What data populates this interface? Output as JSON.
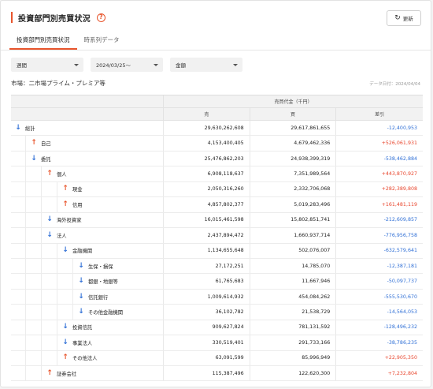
{
  "header": {
    "title": "投資部門別売買状況",
    "help_icon": "?",
    "update_label": "更新",
    "update_icon": "↻"
  },
  "tabs": [
    {
      "label": "投資部門別売買状況",
      "active": true
    },
    {
      "label": "時系列データ",
      "active": false
    }
  ],
  "filters": [
    {
      "value": "週間"
    },
    {
      "value": "2024/03/25〜"
    },
    {
      "value": "金額"
    }
  ],
  "market_label": "市場：二市場プライム・プレミア等",
  "data_date": "データ日付：2024/04/04",
  "table": {
    "group_header": "売買代金（千円）",
    "columns": [
      "売",
      "買",
      "差引"
    ],
    "rows": [
      {
        "label": "総計",
        "level": 0,
        "dir": "down",
        "sell": "29,630,262,608",
        "buy": "29,617,861,655",
        "diff": "-12,400,953"
      },
      {
        "label": "自己",
        "level": 1,
        "dir": "up",
        "sell": "4,153,400,405",
        "buy": "4,679,462,336",
        "diff": "+526,061,931"
      },
      {
        "label": "委託",
        "level": 1,
        "dir": "down",
        "sell": "25,476,862,203",
        "buy": "24,938,399,319",
        "diff": "-538,462,884"
      },
      {
        "label": "個人",
        "level": 2,
        "dir": "up",
        "sell": "6,908,118,637",
        "buy": "7,351,989,564",
        "diff": "+443,870,927"
      },
      {
        "label": "現金",
        "level": 3,
        "dir": "up",
        "sell": "2,050,316,260",
        "buy": "2,332,706,068",
        "diff": "+282,389,808"
      },
      {
        "label": "信用",
        "level": 3,
        "dir": "up",
        "sell": "4,857,802,377",
        "buy": "5,019,283,496",
        "diff": "+161,481,119"
      },
      {
        "label": "海外投資家",
        "level": 2,
        "dir": "down",
        "sell": "16,015,461,598",
        "buy": "15,802,851,741",
        "diff": "-212,609,857"
      },
      {
        "label": "法人",
        "level": 2,
        "dir": "down",
        "sell": "2,437,894,472",
        "buy": "1,660,937,714",
        "diff": "-776,956,758"
      },
      {
        "label": "金融機関",
        "level": 3,
        "dir": "down",
        "sell": "1,134,655,648",
        "buy": "502,076,007",
        "diff": "-632,579,641"
      },
      {
        "label": "生保・損保",
        "level": 4,
        "dir": "down",
        "sell": "27,172,251",
        "buy": "14,785,070",
        "diff": "-12,387,181"
      },
      {
        "label": "都銀・地銀等",
        "level": 4,
        "dir": "down",
        "sell": "61,765,683",
        "buy": "11,667,946",
        "diff": "-50,097,737"
      },
      {
        "label": "信託銀行",
        "level": 4,
        "dir": "down",
        "sell": "1,009,614,932",
        "buy": "454,084,262",
        "diff": "-555,530,670"
      },
      {
        "label": "その他金融機関",
        "level": 4,
        "dir": "down",
        "sell": "36,102,782",
        "buy": "21,538,729",
        "diff": "-14,564,053"
      },
      {
        "label": "投資信託",
        "level": 3,
        "dir": "down",
        "sell": "909,627,824",
        "buy": "781,131,592",
        "diff": "-128,496,232"
      },
      {
        "label": "事業法人",
        "level": 3,
        "dir": "down",
        "sell": "330,519,401",
        "buy": "291,733,166",
        "diff": "-38,786,235"
      },
      {
        "label": "その他法人",
        "level": 3,
        "dir": "up",
        "sell": "63,091,599",
        "buy": "85,996,949",
        "diff": "+22,905,350"
      },
      {
        "label": "証券会社",
        "level": 2,
        "dir": "up",
        "sell": "115,387,496",
        "buy": "122,620,300",
        "diff": "+7,232,804"
      }
    ]
  }
}
